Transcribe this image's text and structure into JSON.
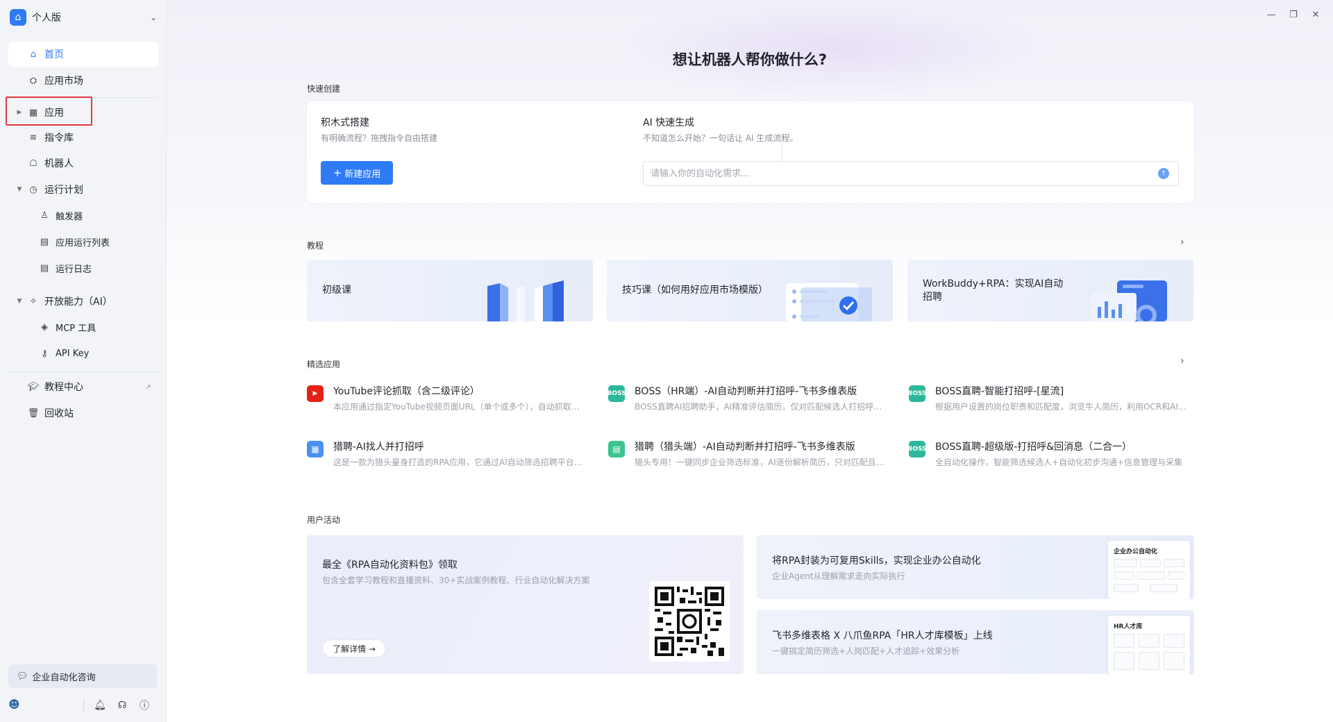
{
  "brand": {
    "name": "个人版"
  },
  "nav": {
    "home": "首页",
    "market": "应用市场",
    "apps": "应用",
    "commands": "指令库",
    "robots": "机器人",
    "schedule": "运行计划",
    "triggers": "触发器",
    "run_list": "应用运行列表",
    "run_log": "运行日志",
    "open_ai": "开放能力（AI）",
    "mcp": "MCP 工具",
    "api_key": "API Key",
    "tutorial_center": "教程中心",
    "trash": "回收站"
  },
  "consult": {
    "label": "企业自动化咨询"
  },
  "hero": {
    "title": "想让机器人帮你做什么?"
  },
  "quick_create": {
    "section": "快速创建",
    "builder_title": "积木式搭建",
    "builder_sub": "有明确流程？拖拽指令自由搭建",
    "new_app": "新建应用",
    "ai_title": "AI 快速生成",
    "ai_sub": "不知道怎么开始？一句话让 AI 生成流程。",
    "ai_placeholder": "请输入你的自动化需求..."
  },
  "tutorials": {
    "section": "教程",
    "items": [
      {
        "title": "初级课"
      },
      {
        "title": "技巧课（如何用好应用市场模版）"
      },
      {
        "title": "WorkBuddy+RPA：实现AI自动招聘"
      }
    ]
  },
  "featured": {
    "section": "精选应用",
    "items": [
      {
        "name": "YouTube评论抓取（含二级评论）",
        "desc": "本应用通过指定YouTube视频页面URL（单个或多个），自动抓取视频评论及二级评论",
        "icon": "youtube-icon",
        "color": "#e62117"
      },
      {
        "name": "BOSS（HR端）-AI自动判断并打招呼-飞书多维表版",
        "desc": "BOSS直聘AI招聘助手，AI精准评估简历，仅对匹配候选人打招呼并同步至飞书",
        "icon": "boss-icon",
        "color": "#2bb89a"
      },
      {
        "name": "BOSS直聘-智能打招呼-[星流]",
        "desc": "根据用户设置的岗位职责和匹配度，浏览牛人简历，利用OCR和AI判断是否打招呼",
        "icon": "boss-icon",
        "color": "#2bb89a"
      },
      {
        "name": "猎聘-AI找人并打招呼",
        "desc": "这是一款为猎头量身打造的RPA应用，它通过AI自动筛选招聘平台上的候选人",
        "icon": "grid-app-icon",
        "color": "#4a90f0"
      },
      {
        "name": "猎聘（猎头端）-AI自动判断并打招呼-飞书多维表版",
        "desc": "猎头专用！一键同步企业筛选标准，AI逐份解析简历，只对匹配且合适的人打招呼",
        "icon": "doc-app-icon",
        "color": "#3cc48a"
      },
      {
        "name": "BOSS直聘-超级版-打招呼&回消息（二合一）",
        "desc": "全自动化操作，智能筛选候选人+自动化初步沟通+信息管理与采集",
        "icon": "boss-icon",
        "color": "#2bb89a"
      }
    ]
  },
  "activities": {
    "section": "用户活动",
    "big": {
      "title": "最全《RPA自动化资料包》领取",
      "sub": "包含全套学习教程和直播资料、30+实战案例教程、行业自动化解决方案",
      "button": "了解详情 →"
    },
    "card1": {
      "title": "将RPA封装为可复用Skills，实现企业办公自动化",
      "sub": "企业Agent从理解需求走向实际执行",
      "panel_title": "企业办公自动化"
    },
    "card2": {
      "title": "飞书多维表格 X 八爪鱼RPA「HR人才库模板」上线",
      "sub": "一键搞定简历筛选+人岗匹配+人才追踪+效果分析",
      "panel_title": "HR人才库"
    }
  },
  "colors": {
    "accent": "#2f7bf6",
    "highlight": "#e5383b"
  }
}
